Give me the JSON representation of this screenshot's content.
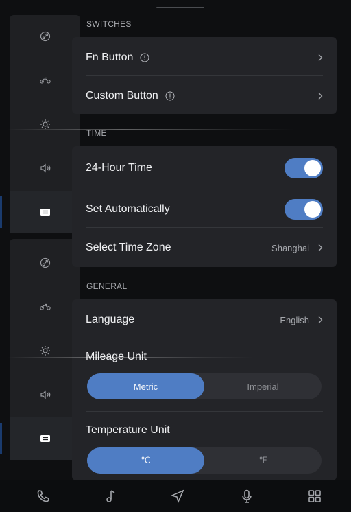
{
  "sections": {
    "switches": "SWITCHES",
    "time": "TIME",
    "general": "GENERAL"
  },
  "switches": {
    "fn_button": "Fn Button",
    "custom_button": "Custom Button"
  },
  "time": {
    "hour24": "24-Hour Time",
    "hour24_on": true,
    "set_auto": "Set Automatically",
    "set_auto_on": true,
    "time_zone_label": "Select Time Zone",
    "time_zone_value": "Shanghai"
  },
  "general": {
    "language_label": "Language",
    "language_value": "English",
    "mileage_label": "Mileage Unit",
    "mileage_options": [
      "Metric",
      "Imperial"
    ],
    "mileage_selected": "Metric",
    "temperature_label": "Temperature Unit",
    "temperature_options": [
      "℃",
      "℉"
    ],
    "temperature_selected": "℃"
  },
  "sidebar": {
    "icons": [
      "link-icon",
      "motorcycle-icon",
      "brightness-icon",
      "volume-icon",
      "settings-switch-icon"
    ],
    "active": "settings-switch-icon"
  },
  "bottom_nav": [
    "phone-icon",
    "music-icon",
    "navigation-icon",
    "microphone-icon",
    "apps-grid-icon"
  ],
  "colors": {
    "accent": "#4f7dc4",
    "card": "#232428",
    "background": "#0e0f11"
  }
}
